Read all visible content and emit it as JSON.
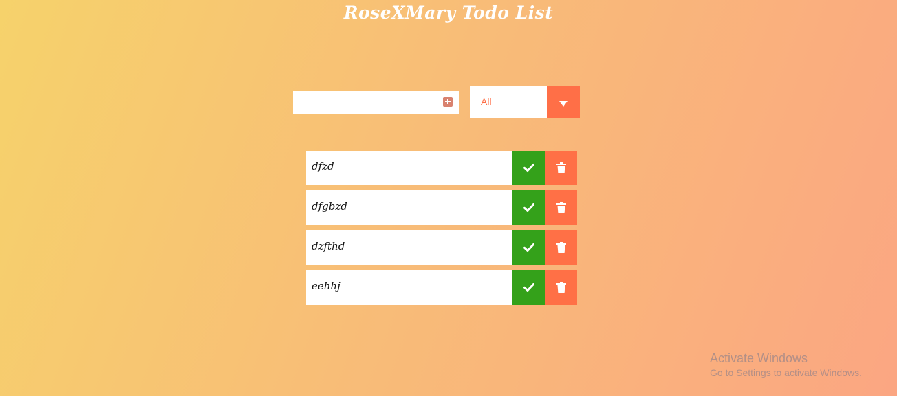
{
  "app": {
    "title": "RoseXMary Todo List"
  },
  "add_form": {
    "input_value": "",
    "input_placeholder": "",
    "add_icon": "plus-square-icon"
  },
  "filter": {
    "selected": "All",
    "arrow_icon": "caret-down-icon"
  },
  "todos": [
    {
      "text": "dfzd"
    },
    {
      "text": "dfgbzd"
    },
    {
      "text": "dzfthd"
    },
    {
      "text": "eehhj"
    }
  ],
  "icons": {
    "complete": "check-icon",
    "delete": "trash-icon"
  },
  "colors": {
    "accent": "#ff6f47",
    "complete": "#34a11a",
    "trash": "#ff7046",
    "add_icon": "#d9826f"
  },
  "watermark": {
    "title": "Activate Windows",
    "subtitle": "Go to Settings to activate Windows."
  }
}
